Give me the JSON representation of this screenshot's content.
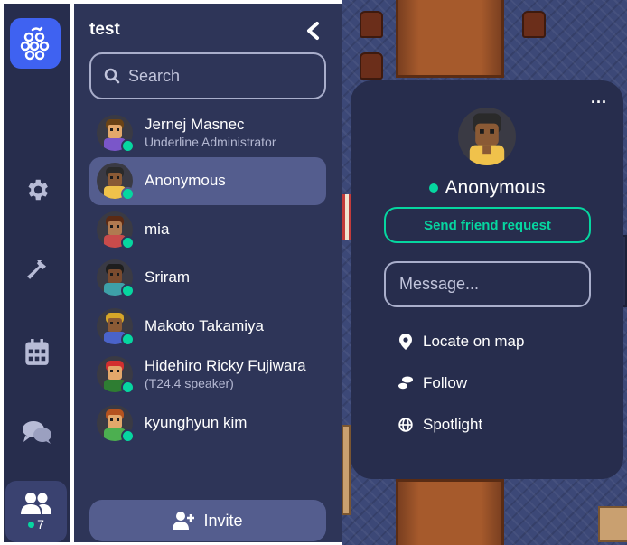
{
  "space": {
    "title": "test"
  },
  "search": {
    "placeholder": "Search"
  },
  "rail": {
    "items": [
      {
        "name": "settings",
        "icon": "gear-icon"
      },
      {
        "name": "build",
        "icon": "hammer-icon"
      },
      {
        "name": "calendar",
        "icon": "calendar-icon"
      },
      {
        "name": "chat",
        "icon": "chat-icon"
      }
    ],
    "participants_count": "7"
  },
  "members": [
    {
      "name": "Jernej Masnec",
      "sub": "Underline Administrator",
      "status": "online",
      "skin": "#e3a86b",
      "hair": "#6a4316",
      "shirt": "#7a56c9"
    },
    {
      "name": "Anonymous",
      "sub": "",
      "status": "online",
      "selected": true,
      "skin": "#8a5a35",
      "hair": "#2a2a2a",
      "shirt": "#f0c24b"
    },
    {
      "name": "mia",
      "sub": "",
      "status": "online",
      "skin": "#b07a50",
      "hair": "#5a2a14",
      "shirt": "#c84b4b"
    },
    {
      "name": "Sriram",
      "sub": "",
      "status": "online",
      "skin": "#7a4b2e",
      "hair": "#1e1e1e",
      "shirt": "#3ea0a8"
    },
    {
      "name": "Makoto Takamiya",
      "sub": "",
      "status": "online",
      "skin": "#8a5a35",
      "hair": "#d6a628",
      "shirt": "#4a63c9"
    },
    {
      "name": "Hidehiro Ricky Fujiwara",
      "sub": "(T24.4 speaker)",
      "status": "online",
      "skin": "#e3a86b",
      "hair": "#d32f2f",
      "shirt": "#2e7d32"
    },
    {
      "name": "kyunghyun kim",
      "sub": "",
      "status": "online",
      "skin": "#e3a86b",
      "hair": "#b5531f",
      "shirt": "#4caf50"
    }
  ],
  "invite": {
    "label": "Invite"
  },
  "profile": {
    "name": "Anonymous",
    "status": "online",
    "friend_request_label": "Send friend request",
    "message_placeholder": "Message...",
    "actions": [
      {
        "label": "Locate on map",
        "icon": "location-pin-icon"
      },
      {
        "label": "Follow",
        "icon": "footsteps-icon"
      },
      {
        "label": "Spotlight",
        "icon": "globe-icon"
      }
    ]
  },
  "colors": {
    "accent_green": "#06d6a0",
    "brand_blue": "#3f62f1",
    "panel_bg": "#2e3558",
    "rail_bg": "#272d4d",
    "selected_bg": "#545d8e"
  }
}
